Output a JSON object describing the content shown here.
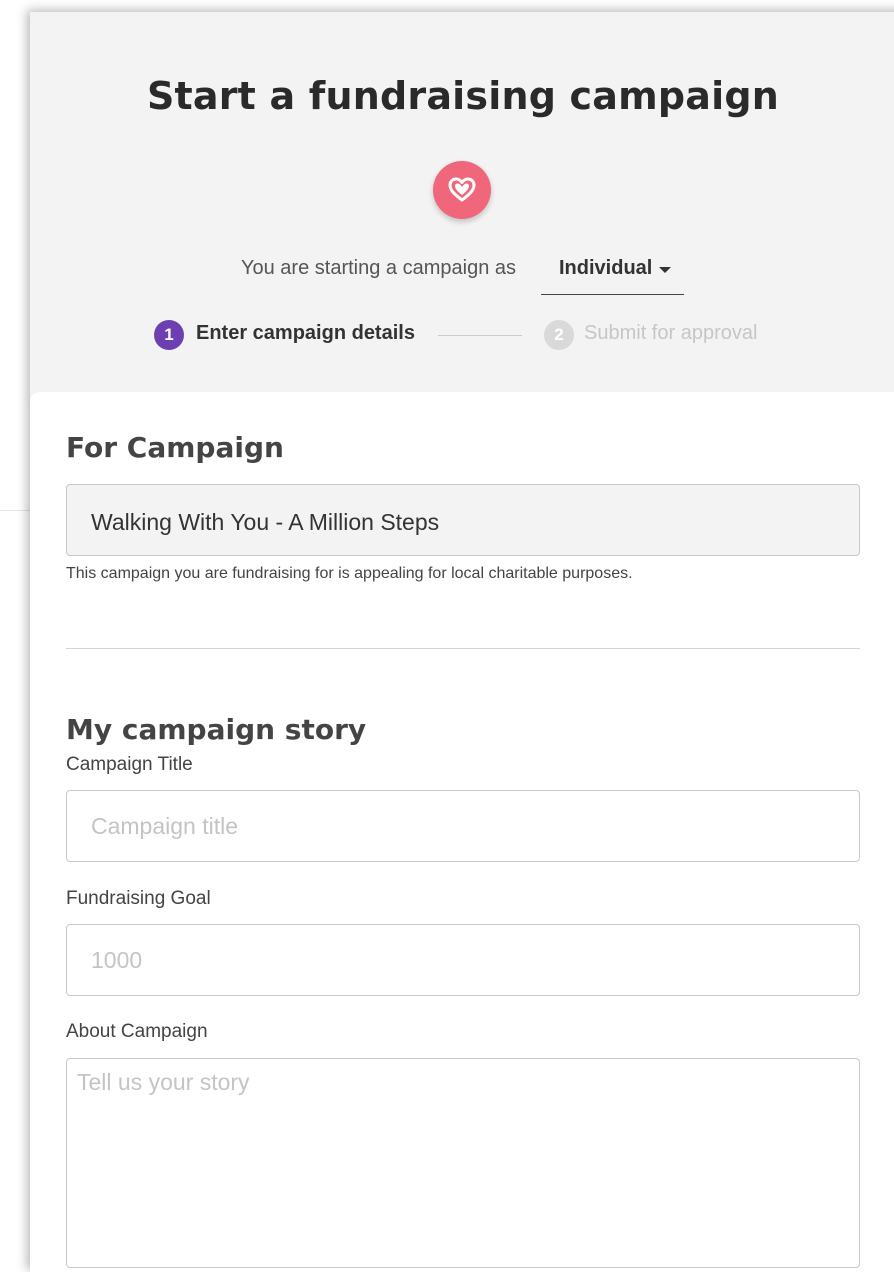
{
  "header": {
    "title": "Start a fundraising campaign",
    "icon": "heart-icon",
    "accent_color": "#f0667a"
  },
  "role_selector": {
    "prefix": "You are starting a campaign as",
    "selected": "Individual"
  },
  "steps": [
    {
      "number": "1",
      "label": "Enter campaign details",
      "state": "active",
      "color": "#6e3fb0"
    },
    {
      "number": "2",
      "label": "Submit for approval",
      "state": "inactive",
      "color": "#d9d9d9"
    }
  ],
  "for_campaign": {
    "heading": "For Campaign",
    "value": "Walking With You - A Million Steps",
    "helper": "This campaign you are fundraising for is appealing for local charitable purposes."
  },
  "story": {
    "heading": "My campaign story",
    "title_label": "Campaign Title",
    "title_placeholder": "Campaign title",
    "goal_label": "Fundraising Goal",
    "goal_placeholder": "1000",
    "about_label": "About Campaign",
    "about_placeholder": "Tell us your story"
  }
}
